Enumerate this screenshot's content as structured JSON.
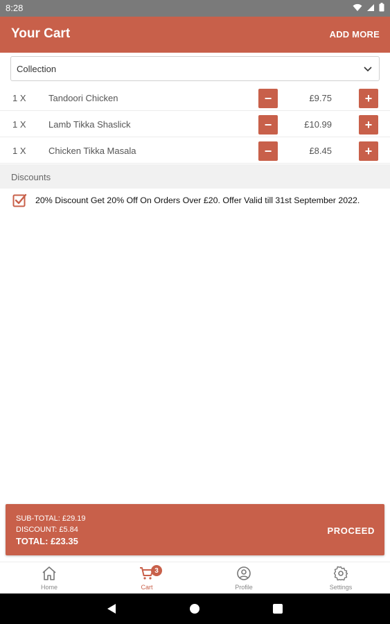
{
  "status_bar": {
    "time": "8:28"
  },
  "header": {
    "title": "Your Cart",
    "add_more": "ADD MORE"
  },
  "order_type": {
    "selected": "Collection"
  },
  "cart_items": [
    {
      "qty": "1 X",
      "name": "Tandoori Chicken",
      "price": "£9.75"
    },
    {
      "qty": "1 X",
      "name": "Lamb Tikka Shaslick",
      "price": "£10.99"
    },
    {
      "qty": "1 X",
      "name": "Chicken Tikka Masala",
      "price": "£8.45"
    }
  ],
  "buttons": {
    "minus": "−",
    "plus": "+"
  },
  "discounts": {
    "header": "Discounts",
    "items": [
      {
        "text": "20% Discount Get 20% Off On Orders Over £20. Offer Valid till 31st September 2022.",
        "checked": true
      }
    ]
  },
  "summary": {
    "subtotal": "SUB-TOTAL: £29.19",
    "discount": "DISCOUNT: £5.84",
    "total": "TOTAL: £23.35",
    "proceed": "PROCEED"
  },
  "bottom_nav": {
    "items": [
      {
        "label": "Home",
        "icon": "home-icon"
      },
      {
        "label": "Cart",
        "icon": "cart-icon",
        "badge": "3",
        "active": true
      },
      {
        "label": "Profile",
        "icon": "profile-icon"
      },
      {
        "label": "Settings",
        "icon": "gear-icon"
      }
    ]
  },
  "colors": {
    "accent": "#c8604a",
    "status_bar": "#7a7a7a"
  }
}
